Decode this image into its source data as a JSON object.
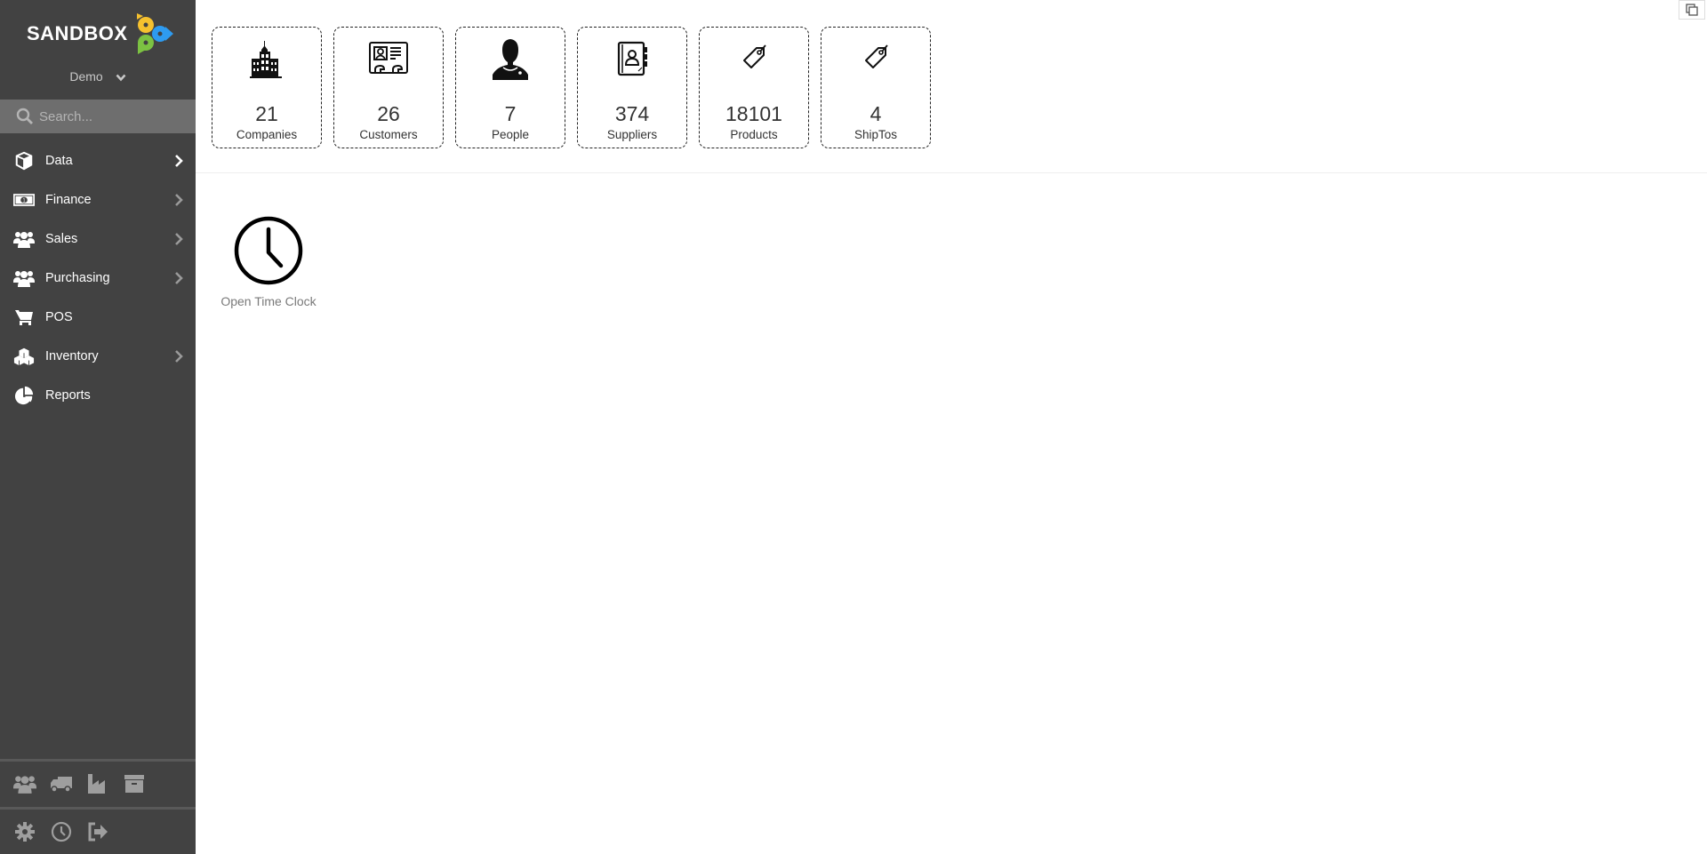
{
  "app": {
    "logo_text": "SANDBOX",
    "tenant": "Demo"
  },
  "search": {
    "placeholder": "Search..."
  },
  "sidebar": {
    "items": [
      {
        "label": "Data",
        "icon": "cube-icon",
        "has_submenu": true
      },
      {
        "label": "Finance",
        "icon": "money-icon",
        "has_submenu": true
      },
      {
        "label": "Sales",
        "icon": "users-icon",
        "has_submenu": true
      },
      {
        "label": "Purchasing",
        "icon": "users-icon",
        "has_submenu": true
      },
      {
        "label": "POS",
        "icon": "cart-icon",
        "has_submenu": false
      },
      {
        "label": "Inventory",
        "icon": "boxes-icon",
        "has_submenu": true
      },
      {
        "label": "Reports",
        "icon": "pie-chart-icon",
        "has_submenu": false
      }
    ],
    "quick_links": [
      "users-icon",
      "truck-icon",
      "factory-icon",
      "archive-icon"
    ],
    "footer_links": [
      "gear-icon",
      "clock-icon",
      "sign-out-icon"
    ]
  },
  "stats": [
    {
      "value": "21",
      "label": "Companies",
      "icon": "buildings-icon"
    },
    {
      "value": "26",
      "label": "Customers",
      "icon": "id-card-icon"
    },
    {
      "value": "7",
      "label": "People",
      "icon": "person-icon"
    },
    {
      "value": "374",
      "label": "Suppliers",
      "icon": "address-book-icon"
    },
    {
      "value": "18101",
      "label": "Products",
      "icon": "tag-icon"
    },
    {
      "value": "4",
      "label": "ShipTos",
      "icon": "tag-icon"
    }
  ],
  "tiles": [
    {
      "label": "Open Time Clock",
      "icon": "clock-icon"
    }
  ],
  "colors": {
    "sidebar_bg": "#424242",
    "search_bg": "#6e6e6e",
    "logo_yellow": "#f6c12e",
    "logo_blue": "#2e9bf0",
    "logo_green": "#7cc242"
  }
}
